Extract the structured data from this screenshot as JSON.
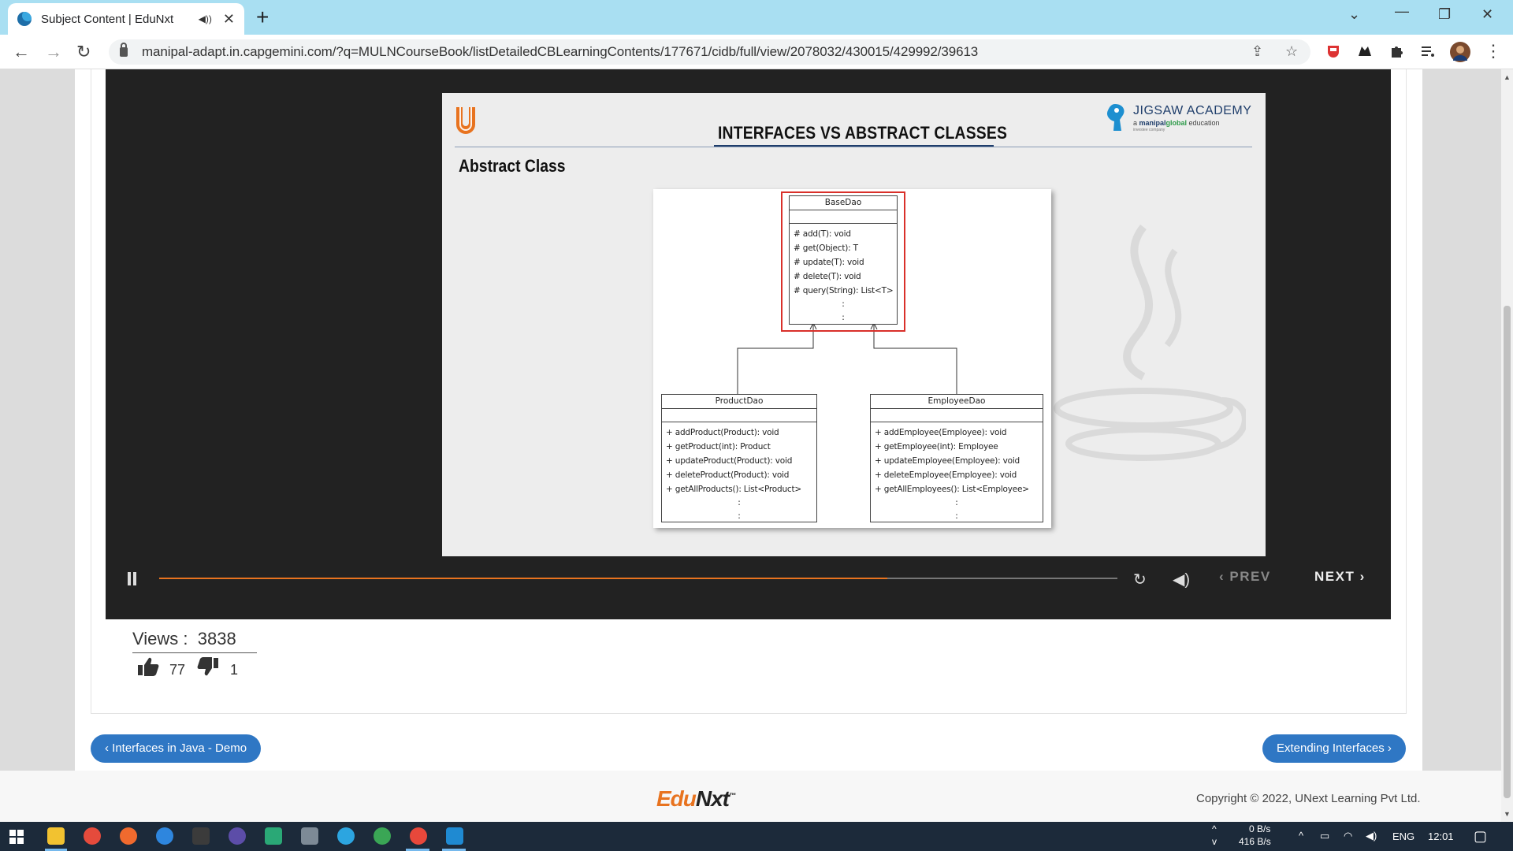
{
  "browser": {
    "tab_title": "Subject Content | EduNxt",
    "tab_audio_icon": "speaker-icon",
    "new_tab": "+",
    "url": "manipal-adapt.in.capgemini.com/?q=MULNCourseBook/listDetailedCBLearningContents/177671/cidb/full/view/2078032/430015/429992/39613"
  },
  "slide": {
    "title": "INTERFACES VS ABSTRACT CLASSES",
    "subtitle": "Abstract Class",
    "logo_name": "JIGSAW ACADEMY",
    "logo_tagline_prefix": "a ",
    "logo_tagline_brand_1": "manipal",
    "logo_tagline_brand_2": "global",
    "logo_tagline_suffix": " education",
    "logo_sub": "investee company",
    "uml": {
      "base": {
        "name": "BaseDao",
        "methods": [
          "# add(T): void",
          "# get(Object): T",
          "# update(T): void",
          "# delete(T): void",
          "# query(String): List<T>"
        ],
        "dots": ":"
      },
      "product": {
        "name": "ProductDao",
        "methods": [
          "+ addProduct(Product): void",
          "+ getProduct(int): Product",
          "+ updateProduct(Product): void",
          "+ deleteProduct(Product): void",
          "+ getAllProducts(): List<Product>"
        ],
        "dots": ":"
      },
      "employee": {
        "name": "EmployeeDao",
        "methods": [
          "+ addEmployee(Employee): void",
          "+ getEmployee(int): Employee",
          "+ updateEmployee(Employee): void",
          "+ deleteEmployee(Employee): void",
          "+ getAllEmployees(): List<Employee>"
        ],
        "dots": ":"
      }
    }
  },
  "player": {
    "progress_fraction": 0.76,
    "prev_label": "PREV",
    "next_label": "NEXT",
    "accent_color": "#e8731f"
  },
  "stats": {
    "views_label": "Views :",
    "views_count": "3838",
    "likes": "77",
    "dislikes": "1"
  },
  "navigation": {
    "prev_lesson": "‹ Interfaces in Java - Demo",
    "next_lesson": "Extending Interfaces ›"
  },
  "footer": {
    "logo_part1": "Edu",
    "logo_part2": "Nxt",
    "logo_mark": "™",
    "copyright": "Copyright © 2022, UNext Learning Pvt Ltd."
  },
  "taskbar": {
    "net_up": "0 B/s",
    "net_down": "416 B/s",
    "language": "ENG",
    "time": "12:01"
  }
}
